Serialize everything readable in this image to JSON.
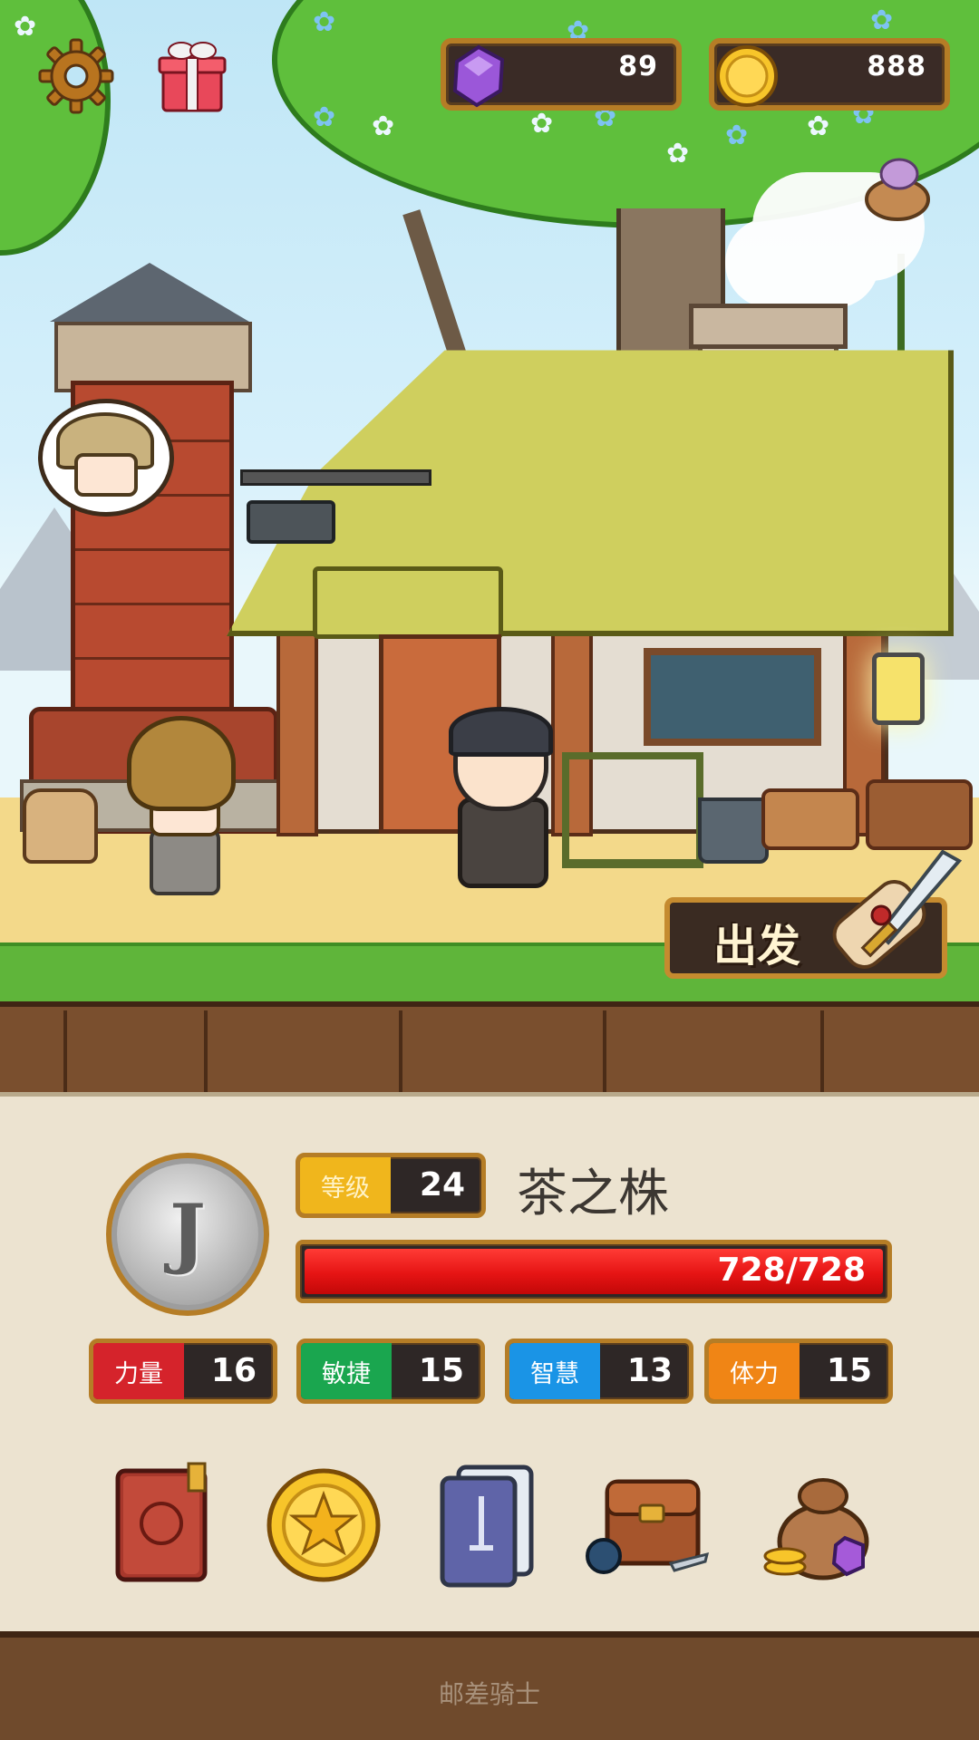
{
  "hud": {
    "gems": "89",
    "coins": "888"
  },
  "scene": {
    "depart_label": "出发"
  },
  "hero": {
    "avatar_letter": "J",
    "level_label": "等级",
    "level": "24",
    "name": "茶之株",
    "hp_text": "728/728",
    "hp_fraction": 1.0
  },
  "stats": [
    {
      "label": "力量",
      "value": "16"
    },
    {
      "label": "敏捷",
      "value": "15"
    },
    {
      "label": "智慧",
      "value": "13"
    },
    {
      "label": "体力",
      "value": "15"
    }
  ],
  "menu": [
    {
      "icon": "hero-book-icon"
    },
    {
      "icon": "star-coin-icon"
    },
    {
      "icon": "card-deck-icon"
    },
    {
      "icon": "backpack-icon"
    },
    {
      "icon": "loot-bag-icon"
    }
  ],
  "footer": "邮差骑士",
  "colors": {
    "frame_gold": "#b57d26",
    "hp_red": "#e61414",
    "strength": "#d5232b",
    "agility": "#1aa64f",
    "wisdom": "#1a94e6",
    "stamina": "#f08515",
    "level": "#f0b61c"
  }
}
